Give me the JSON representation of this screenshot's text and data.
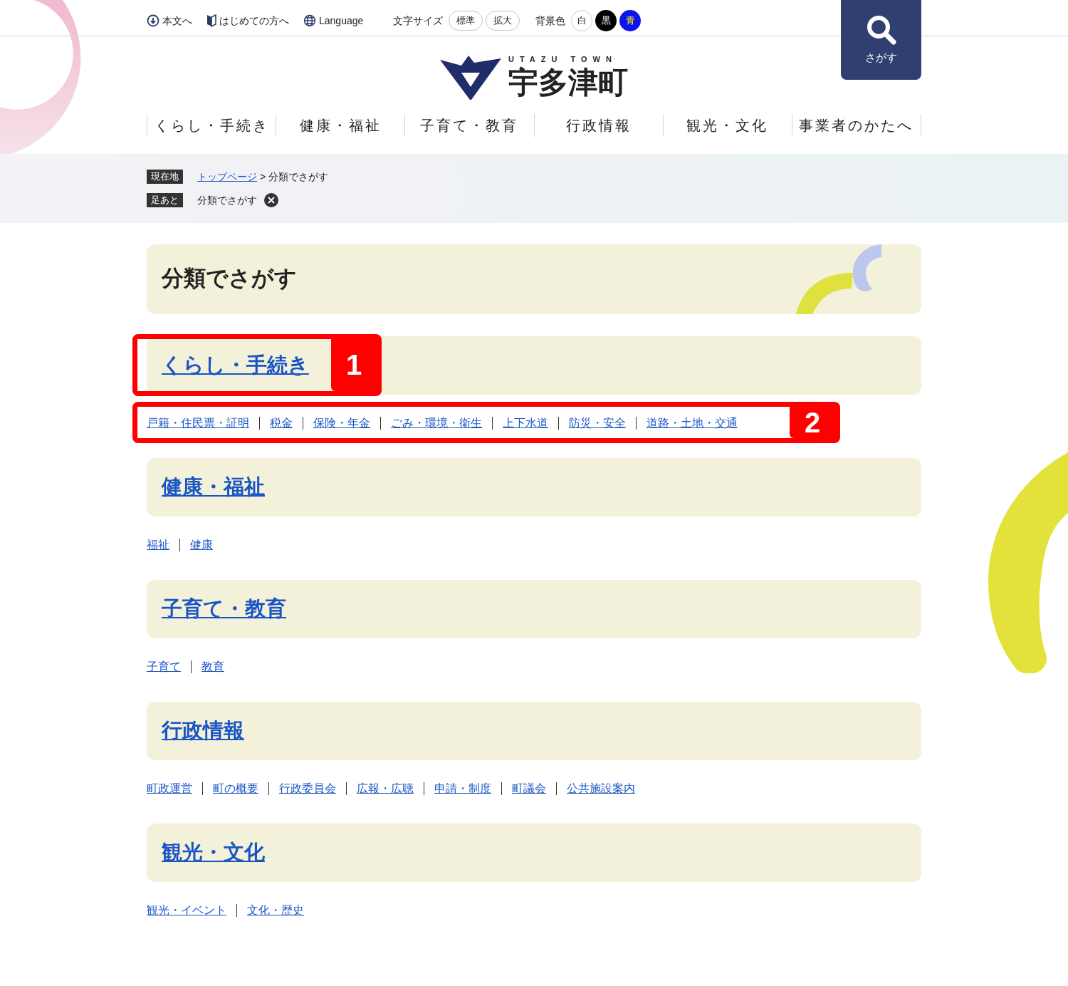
{
  "utility_bar": {
    "links": [
      "本文へ",
      "はじめての方へ",
      "Language"
    ],
    "font_size": {
      "label": "文字サイズ",
      "options": [
        "標準",
        "拡大"
      ]
    },
    "background": {
      "label": "背景色",
      "options": [
        {
          "label": "白",
          "color": "#ffffff"
        },
        {
          "label": "黒",
          "color": "#000000"
        },
        {
          "label": "青",
          "color": "#0a14f0"
        }
      ]
    }
  },
  "search_button": {
    "label": "さがす"
  },
  "logo": {
    "subtitle": "UTAZU TOWN",
    "name": "宇多津町"
  },
  "global_nav": [
    "くらし・手続き",
    "健康・福祉",
    "子育て・教育",
    "行政情報",
    "観光・文化",
    "事業者のかたへ"
  ],
  "breadcrumb": {
    "current_label": "現在地",
    "separator": ">",
    "trail": [
      {
        "text": "トップページ",
        "link": true
      },
      {
        "text": "分類でさがす",
        "link": false
      }
    ],
    "history_label": "足あと",
    "history": [
      "分類でさがす"
    ]
  },
  "page_title": "分類でさがす",
  "categories": [
    {
      "title": "くらし・手続き",
      "callout": "1",
      "links_callout": "2",
      "links": [
        "戸籍・住民票・証明",
        "税金",
        "保険・年金",
        "ごみ・環境・衛生",
        "上下水道",
        "防災・安全",
        "道路・土地・交通"
      ]
    },
    {
      "title": "健康・福祉",
      "links": [
        "福祉",
        "健康"
      ]
    },
    {
      "title": "子育て・教育",
      "links": [
        "子育て",
        "教育"
      ]
    },
    {
      "title": "行政情報",
      "links": [
        "町政運営",
        "町の概要",
        "行政委員会",
        "広報・広聴",
        "申請・制度",
        "町議会",
        "公共施設案内"
      ]
    },
    {
      "title": "観光・文化",
      "links": [
        "観光・イベント",
        "文化・歴史"
      ]
    }
  ]
}
